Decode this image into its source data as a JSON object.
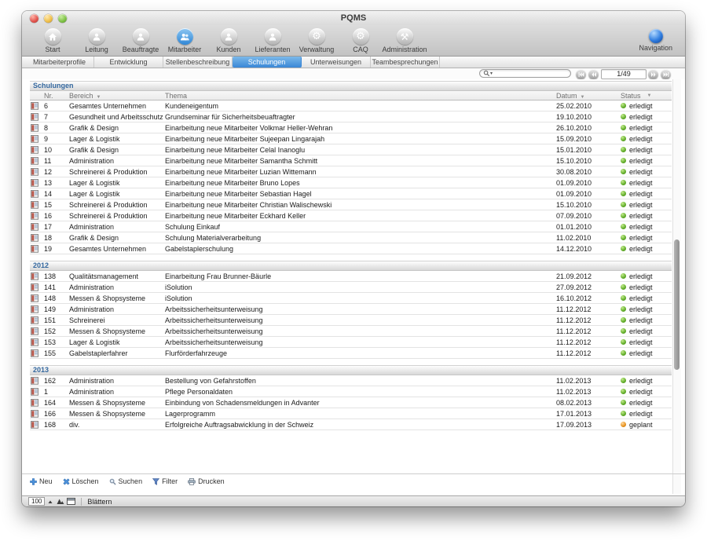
{
  "window": {
    "title": "PQMS"
  },
  "toolbar": {
    "items": [
      {
        "label": "Start",
        "icon": "home",
        "active": false
      },
      {
        "label": "Leitung",
        "icon": "person",
        "active": false
      },
      {
        "label": "Beauftragte",
        "icon": "person",
        "active": false
      },
      {
        "label": "Mitarbeiter",
        "icon": "people",
        "active": true
      },
      {
        "label": "Kunden",
        "icon": "person",
        "active": false
      },
      {
        "label": "Lieferanten",
        "icon": "person",
        "active": false
      },
      {
        "label": "Verwaltung",
        "icon": "gear",
        "active": false
      },
      {
        "label": "CAQ",
        "icon": "gear",
        "active": false
      },
      {
        "label": "Administration",
        "icon": "tools",
        "active": false
      }
    ],
    "navigation": {
      "label": "Navigation",
      "icon": "globe"
    }
  },
  "tabs": {
    "items": [
      "Mitarbeiterprofile",
      "Entwicklung",
      "Stellenbeschreibung",
      "Schulungen",
      "Unterweisungen",
      "Teambesprechungen"
    ],
    "active": "Schulungen"
  },
  "search": {
    "placeholder": "",
    "value": ""
  },
  "record_nav": {
    "counter": "1/49"
  },
  "table": {
    "title": "Schulungen",
    "columns": [
      {
        "label": "Nr.",
        "key": "nr",
        "sortable": false
      },
      {
        "label": "Bereich",
        "key": "bereich",
        "sortable": true
      },
      {
        "label": "Thema",
        "key": "thema",
        "sortable": false
      },
      {
        "label": "Datum",
        "key": "datum",
        "sortable": true
      },
      {
        "label": "Status",
        "key": "status",
        "sortable": true
      }
    ],
    "status_colors": {
      "erledigt": "#5aa21f",
      "geplant": "#e8921c"
    },
    "groups": [
      {
        "label": "",
        "rows": [
          {
            "nr": "6",
            "bereich": "Gesamtes Unternehmen",
            "thema": "Kundeneigentum",
            "datum": "25.02.2010",
            "status": "erledigt"
          },
          {
            "nr": "7",
            "bereich": "Gesundheit und Arbeitsschutz",
            "thema": "Grundseminar für Sicherheitsbeuaftragter",
            "datum": "19.10.2010",
            "status": "erledigt"
          },
          {
            "nr": "8",
            "bereich": "Grafik & Design",
            "thema": "Einarbeitung neue Mitarbeiter Volkmar Heller-Wehran",
            "datum": "26.10.2010",
            "status": "erledigt"
          },
          {
            "nr": "9",
            "bereich": "Lager & Logistik",
            "thema": "Einarbeitung neue Mitarbeiter Sujeepan Lingarajah",
            "datum": "15.09.2010",
            "status": "erledigt"
          },
          {
            "nr": "10",
            "bereich": "Grafik & Design",
            "thema": "Einarbeitung neue Mitarbeiter Celal Inanoglu",
            "datum": "15.01.2010",
            "status": "erledigt"
          },
          {
            "nr": "11",
            "bereich": "Administration",
            "thema": "Einarbeitung neue Mitarbeiter Samantha Schmitt",
            "datum": "15.10.2010",
            "status": "erledigt"
          },
          {
            "nr": "12",
            "bereich": "Schreinerei & Produktion",
            "thema": "Einarbeitung neue Mitarbeiter Luzian Wittemann",
            "datum": "30.08.2010",
            "status": "erledigt"
          },
          {
            "nr": "13",
            "bereich": "Lager & Logistik",
            "thema": "Einarbeitung neue Mitarbeiter Bruno Lopes",
            "datum": "01.09.2010",
            "status": "erledigt"
          },
          {
            "nr": "14",
            "bereich": "Lager & Logistik",
            "thema": "Einarbeitung neue Mitarbeiter Sebastian Hagel",
            "datum": "01.09.2010",
            "status": "erledigt"
          },
          {
            "nr": "15",
            "bereich": "Schreinerei & Produktion",
            "thema": "Einarbeitung neue Mitarbeiter Christian Walischewski",
            "datum": "15.10.2010",
            "status": "erledigt"
          },
          {
            "nr": "16",
            "bereich": "Schreinerei & Produktion",
            "thema": "Einarbeitung neue Mitarbeiter Eckhard Keller",
            "datum": "07.09.2010",
            "status": "erledigt"
          },
          {
            "nr": "17",
            "bereich": "Administration",
            "thema": "Schulung Einkauf",
            "datum": "01.01.2010",
            "status": "erledigt"
          },
          {
            "nr": "18",
            "bereich": "Grafik & Design",
            "thema": "Schulung Materialverarbeitung",
            "datum": "11.02.2010",
            "status": "erledigt"
          },
          {
            "nr": "19",
            "bereich": "Gesamtes Unternehmen",
            "thema": "Gabelstaplerschulung",
            "datum": "14.12.2010",
            "status": "erledigt"
          }
        ]
      },
      {
        "label": "2012",
        "rows": [
          {
            "nr": "138",
            "bereich": "Qualitätsmanagement",
            "thema": "Einarbeitung Frau Brunner-Bäurle",
            "datum": "21.09.2012",
            "status": "erledigt"
          },
          {
            "nr": "141",
            "bereich": "Administration",
            "thema": "iSolution",
            "datum": "27.09.2012",
            "status": "erledigt"
          },
          {
            "nr": "148",
            "bereich": "Messen & Shopsysteme",
            "thema": "iSolution",
            "datum": "16.10.2012",
            "status": "erledigt"
          },
          {
            "nr": "149",
            "bereich": "Administration",
            "thema": "Arbeitssicherheitsunterweisung",
            "datum": "11.12.2012",
            "status": "erledigt"
          },
          {
            "nr": "151",
            "bereich": "Schreinerei",
            "thema": "Arbeitssicherheitsunterweisung",
            "datum": "11.12.2012",
            "status": "erledigt"
          },
          {
            "nr": "152",
            "bereich": "Messen & Shopsysteme",
            "thema": "Arbeitssicherheitsunterweisung",
            "datum": "11.12.2012",
            "status": "erledigt"
          },
          {
            "nr": "153",
            "bereich": "Lager & Logistik",
            "thema": "Arbeitssicherheitsunterweisung",
            "datum": "11.12.2012",
            "status": "erledigt"
          },
          {
            "nr": "155",
            "bereich": "Gabelstaplerfahrer",
            "thema": "Flurförderfahrzeuge",
            "datum": "11.12.2012",
            "status": "erledigt"
          }
        ]
      },
      {
        "label": "2013",
        "rows": [
          {
            "nr": "162",
            "bereich": "Administration",
            "thema": "Bestellung von Gefahrstoffen",
            "datum": "11.02.2013",
            "status": "erledigt"
          },
          {
            "nr": "1",
            "bereich": "Administration",
            "thema": "Pflege Personaldaten",
            "datum": "11.02.2013",
            "status": "erledigt"
          },
          {
            "nr": "164",
            "bereich": "Messen & Shopsysteme",
            "thema": "Einbindung von Schadensmeldungen in Advanter",
            "datum": "08.02.2013",
            "status": "erledigt"
          },
          {
            "nr": "166",
            "bereich": "Messen & Shopsysteme",
            "thema": "Lagerprogramm",
            "datum": "17.01.2013",
            "status": "erledigt"
          },
          {
            "nr": "168",
            "bereich": "div.",
            "thema": "Erfolgreiche Auftragsabwicklung in der Schweiz",
            "datum": "17.09.2013",
            "status": "geplant"
          }
        ]
      }
    ]
  },
  "footer": {
    "buttons": [
      {
        "label": "Neu",
        "icon": "plus"
      },
      {
        "label": "Löschen",
        "icon": "delete-x"
      },
      {
        "label": "Suchen",
        "icon": "magnifier"
      },
      {
        "label": "Filter",
        "icon": "funnel"
      },
      {
        "label": "Drucken",
        "icon": "printer"
      }
    ]
  },
  "statusbar": {
    "zoom_level": "100",
    "mode": "Blättern"
  }
}
